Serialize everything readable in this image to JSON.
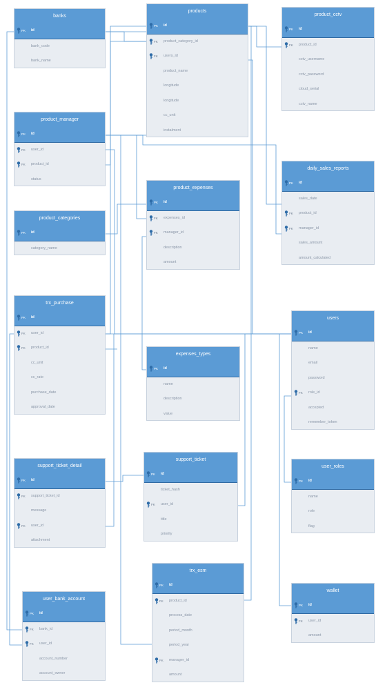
{
  "colors": {
    "header": "#5b9bd5",
    "body": "#e9edf2",
    "key": "#2e6ca8",
    "line": "#5b9bd5"
  },
  "icon": "key-icon",
  "entities": [
    {
      "name": "banks",
      "fields": [
        {
          "name": "id",
          "key": "PK"
        },
        {
          "name": "bank_code"
        },
        {
          "name": "bank_name"
        }
      ]
    },
    {
      "name": "products",
      "fields": [
        {
          "name": "id",
          "key": "PK"
        },
        {
          "name": "product_category_id",
          "key": "FK"
        },
        {
          "name": "users_id",
          "key": "FK"
        },
        {
          "name": "product_name"
        },
        {
          "name": "longitude"
        },
        {
          "name": "longitude"
        },
        {
          "name": "cc_unit"
        },
        {
          "name": "instalment"
        }
      ]
    },
    {
      "name": "product_cctv",
      "fields": [
        {
          "name": "id",
          "key": "PK"
        },
        {
          "name": "product_id",
          "key": "FK"
        },
        {
          "name": "cctv_username"
        },
        {
          "name": "cctv_password"
        },
        {
          "name": "cloud_serial"
        },
        {
          "name": "cctv_name"
        }
      ]
    },
    {
      "name": "product_manager",
      "fields": [
        {
          "name": "id",
          "key": "PK"
        },
        {
          "name": "user_id",
          "key": "FK"
        },
        {
          "name": "product_id",
          "key": "FK"
        },
        {
          "name": "status"
        }
      ]
    },
    {
      "name": "daily_sales_reports",
      "fields": [
        {
          "name": "id",
          "key": "PK"
        },
        {
          "name": "sales_date"
        },
        {
          "name": "product_id",
          "key": "FK"
        },
        {
          "name": "manager_id",
          "key": "FK"
        },
        {
          "name": "sales_amount"
        },
        {
          "name": "amount_calculated"
        }
      ]
    },
    {
      "name": "product_expenses",
      "fields": [
        {
          "name": "id",
          "key": "PK"
        },
        {
          "name": "expenses_id",
          "key": "FK"
        },
        {
          "name": "manager_id",
          "key": "FK"
        },
        {
          "name": "description"
        },
        {
          "name": "amount"
        }
      ]
    },
    {
      "name": "product_categories",
      "fields": [
        {
          "name": "id",
          "key": "PK"
        },
        {
          "name": "category_name"
        }
      ]
    },
    {
      "name": "trx_purchase",
      "fields": [
        {
          "name": "id",
          "key": "PK"
        },
        {
          "name": "user_id",
          "key": "FK"
        },
        {
          "name": "product_id",
          "key": "FK"
        },
        {
          "name": "cc_unit"
        },
        {
          "name": "cc_rate"
        },
        {
          "name": "purchase_date"
        },
        {
          "name": "approval_date"
        }
      ]
    },
    {
      "name": "users",
      "fields": [
        {
          "name": "id",
          "key": "PK"
        },
        {
          "name": "name"
        },
        {
          "name": "email"
        },
        {
          "name": "password"
        },
        {
          "name": "role_id",
          "key": "FK"
        },
        {
          "name": "accepted"
        },
        {
          "name": "remember_token"
        }
      ]
    },
    {
      "name": "expenses_types",
      "fields": [
        {
          "name": "id",
          "key": "PK"
        },
        {
          "name": "name"
        },
        {
          "name": "description"
        },
        {
          "name": "value"
        }
      ]
    },
    {
      "name": "support_ticket_detail",
      "fields": [
        {
          "name": "id",
          "key": "PK"
        },
        {
          "name": "support_ticket_id",
          "key": "FK"
        },
        {
          "name": "message"
        },
        {
          "name": "user_id",
          "key": "FK"
        },
        {
          "name": "attachment"
        }
      ]
    },
    {
      "name": "support_ticket",
      "fields": [
        {
          "name": "id",
          "key": "PK"
        },
        {
          "name": "ticket_hash"
        },
        {
          "name": "user_id",
          "key": "FK"
        },
        {
          "name": "title"
        },
        {
          "name": "priority"
        }
      ]
    },
    {
      "name": "user_roles",
      "fields": [
        {
          "name": "id",
          "key": "PK"
        },
        {
          "name": "name"
        },
        {
          "name": "role"
        },
        {
          "name": "flag"
        }
      ]
    },
    {
      "name": "trx_esm",
      "fields": [
        {
          "name": "id",
          "key": "PK"
        },
        {
          "name": "product_id",
          "key": "FK"
        },
        {
          "name": "process_date"
        },
        {
          "name": "period_month"
        },
        {
          "name": "period_year"
        },
        {
          "name": "manager_id",
          "key": "FK"
        },
        {
          "name": "amount"
        }
      ]
    },
    {
      "name": "user_bank_account",
      "fields": [
        {
          "name": "id",
          "key": "PK"
        },
        {
          "name": "bank_id",
          "key": "FK"
        },
        {
          "name": "user_id",
          "key": "FK"
        },
        {
          "name": "account_number"
        },
        {
          "name": "account_owner"
        }
      ]
    },
    {
      "name": "wallet",
      "fields": [
        {
          "name": "id",
          "key": "PK"
        },
        {
          "name": "user_id",
          "key": "FK"
        },
        {
          "name": "amount"
        }
      ]
    }
  ]
}
